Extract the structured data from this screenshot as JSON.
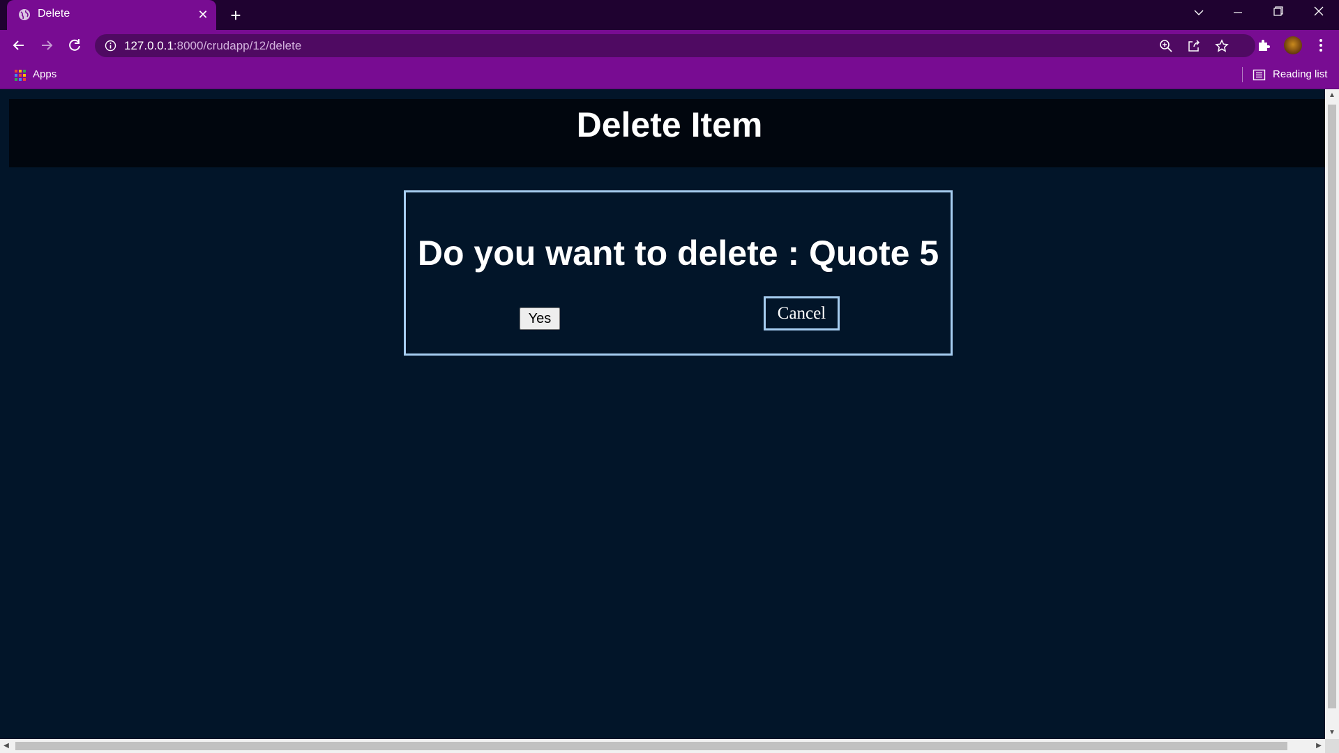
{
  "browser": {
    "tab": {
      "title": "Delete"
    },
    "address": {
      "host": "127.0.0.1",
      "rest": ":8000/crudapp/12/delete"
    },
    "bookmarks": {
      "apps_label": "Apps",
      "reading_list_label": "Reading list"
    }
  },
  "page": {
    "header_title": "Delete Item",
    "question": "Do you want to delete : Quote 5",
    "yes_label": "Yes",
    "cancel_label": "Cancel"
  },
  "colors": {
    "titlebar": "#1f0230",
    "toolbar": "#780c92",
    "page_background": "#021529",
    "header_background": "#01060e",
    "dialog_border": "#a6cdf0"
  },
  "icons": {
    "tab_favicon": "globe-icon",
    "back": "arrow-left-icon",
    "forward": "arrow-right-icon",
    "reload": "reload-icon",
    "site_info": "info-icon",
    "zoom": "zoom-icon",
    "share": "share-icon",
    "bookmark": "star-icon",
    "extensions": "puzzle-icon",
    "menu": "kebab-menu-icon",
    "apps": "apps-grid-icon",
    "reading_list": "reading-list-icon"
  }
}
